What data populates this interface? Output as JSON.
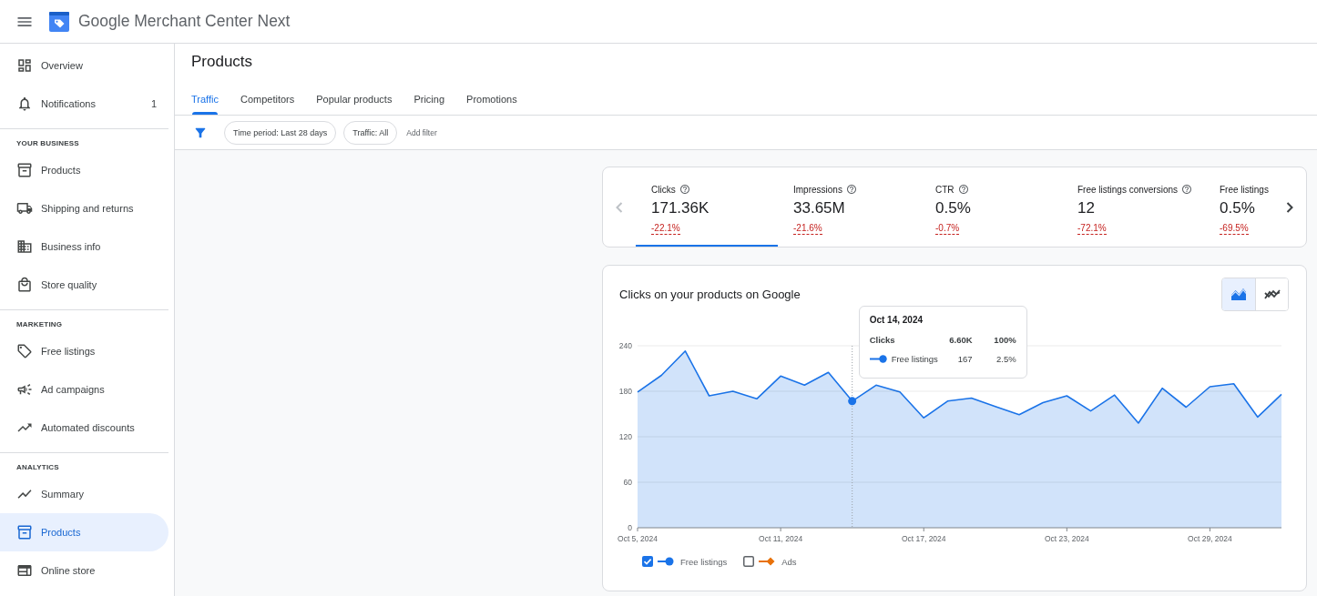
{
  "header": {
    "title": "Google Merchant Center Next"
  },
  "sidebar": {
    "top_items": [
      {
        "label": "Overview",
        "selected": false
      },
      {
        "label": "Notifications",
        "count": "1",
        "selected": false
      }
    ],
    "sections": [
      {
        "heading": "YOUR BUSINESS",
        "items": [
          {
            "label": "Products",
            "selected": false
          },
          {
            "label": "Shipping and returns",
            "selected": false
          },
          {
            "label": "Business info",
            "selected": false
          },
          {
            "label": "Store quality",
            "selected": false
          }
        ]
      },
      {
        "heading": "MARKETING",
        "items": [
          {
            "label": "Free listings",
            "selected": false
          },
          {
            "label": "Ad campaigns",
            "selected": false
          },
          {
            "label": "Automated discounts",
            "selected": false
          }
        ]
      },
      {
        "heading": "ANALYTICS",
        "items": [
          {
            "label": "Summary",
            "selected": false
          },
          {
            "label": "Products",
            "selected": true
          },
          {
            "label": "Online store",
            "selected": false
          }
        ]
      }
    ]
  },
  "page": {
    "title": "Products"
  },
  "tabs": [
    {
      "label": "Traffic",
      "selected": true
    },
    {
      "label": "Competitors",
      "selected": false
    },
    {
      "label": "Popular products",
      "selected": false
    },
    {
      "label": "Pricing",
      "selected": false
    },
    {
      "label": "Promotions",
      "selected": false
    }
  ],
  "filters": {
    "chips": [
      {
        "label": "Time period: Last 28 days"
      },
      {
        "label": "Traffic: All"
      }
    ],
    "add_filter": "Add filter"
  },
  "metrics": {
    "previous": {
      "disabled": true
    },
    "next": {
      "disabled": false
    },
    "items": [
      {
        "label": "Clicks",
        "value": "171.36K",
        "change": "-22.1%",
        "help": true,
        "selected": true
      },
      {
        "label": "Impressions",
        "value": "33.65M",
        "change": "-21.6%",
        "help": true,
        "selected": false
      },
      {
        "label": "CTR",
        "value": "0.5%",
        "change": "-0.7%",
        "help": true,
        "selected": false
      },
      {
        "label": "Free listings conversions",
        "value": "12",
        "change": "-72.1%",
        "help": true,
        "selected": false
      },
      {
        "label": "Free listings",
        "value": "0.5%",
        "change": "-69.5%",
        "help": false,
        "selected": false
      }
    ]
  },
  "chart_card": {
    "title": "Clicks on your products on Google",
    "view_toggle": [
      {
        "kind": "area",
        "selected": true
      },
      {
        "kind": "line",
        "selected": false
      }
    ],
    "chart_data": {
      "type": "area",
      "categories": [
        "Oct 5, 2024",
        null,
        null,
        null,
        null,
        null,
        "Oct 11, 2024",
        null,
        null,
        null,
        null,
        null,
        "Oct 17, 2024",
        null,
        null,
        null,
        null,
        null,
        "Oct 23, 2024",
        null,
        null,
        null,
        null,
        null,
        "Oct 29, 2024",
        null,
        null,
        null
      ],
      "series": [
        {
          "name": "Free listings",
          "color": "#1a73e8",
          "values": [
            179,
            201,
            233,
            174,
            180,
            170,
            200,
            188,
            205,
            167,
            188,
            179,
            145,
            167,
            171,
            160,
            149,
            165,
            174,
            154,
            175,
            138,
            184,
            159,
            186,
            190,
            146,
            176
          ]
        }
      ],
      "ylim": [
        0,
        240
      ],
      "yticks": [
        0,
        60,
        120,
        180,
        240
      ],
      "grid": true
    },
    "tooltip": {
      "title": "Oct 14, 2024",
      "rows": [
        {
          "kind": "total",
          "label": "Clicks",
          "value": "6.60K",
          "share": "100%"
        },
        {
          "kind": "series",
          "value": "167",
          "share": "2.5%"
        }
      ]
    },
    "legend": [
      {
        "label": "Free listings",
        "kind": "dot",
        "color": "#1a73e8",
        "checked": true
      },
      {
        "label": "Ads",
        "kind": "diamond",
        "color": "#e8710a",
        "checked": false
      }
    ]
  }
}
